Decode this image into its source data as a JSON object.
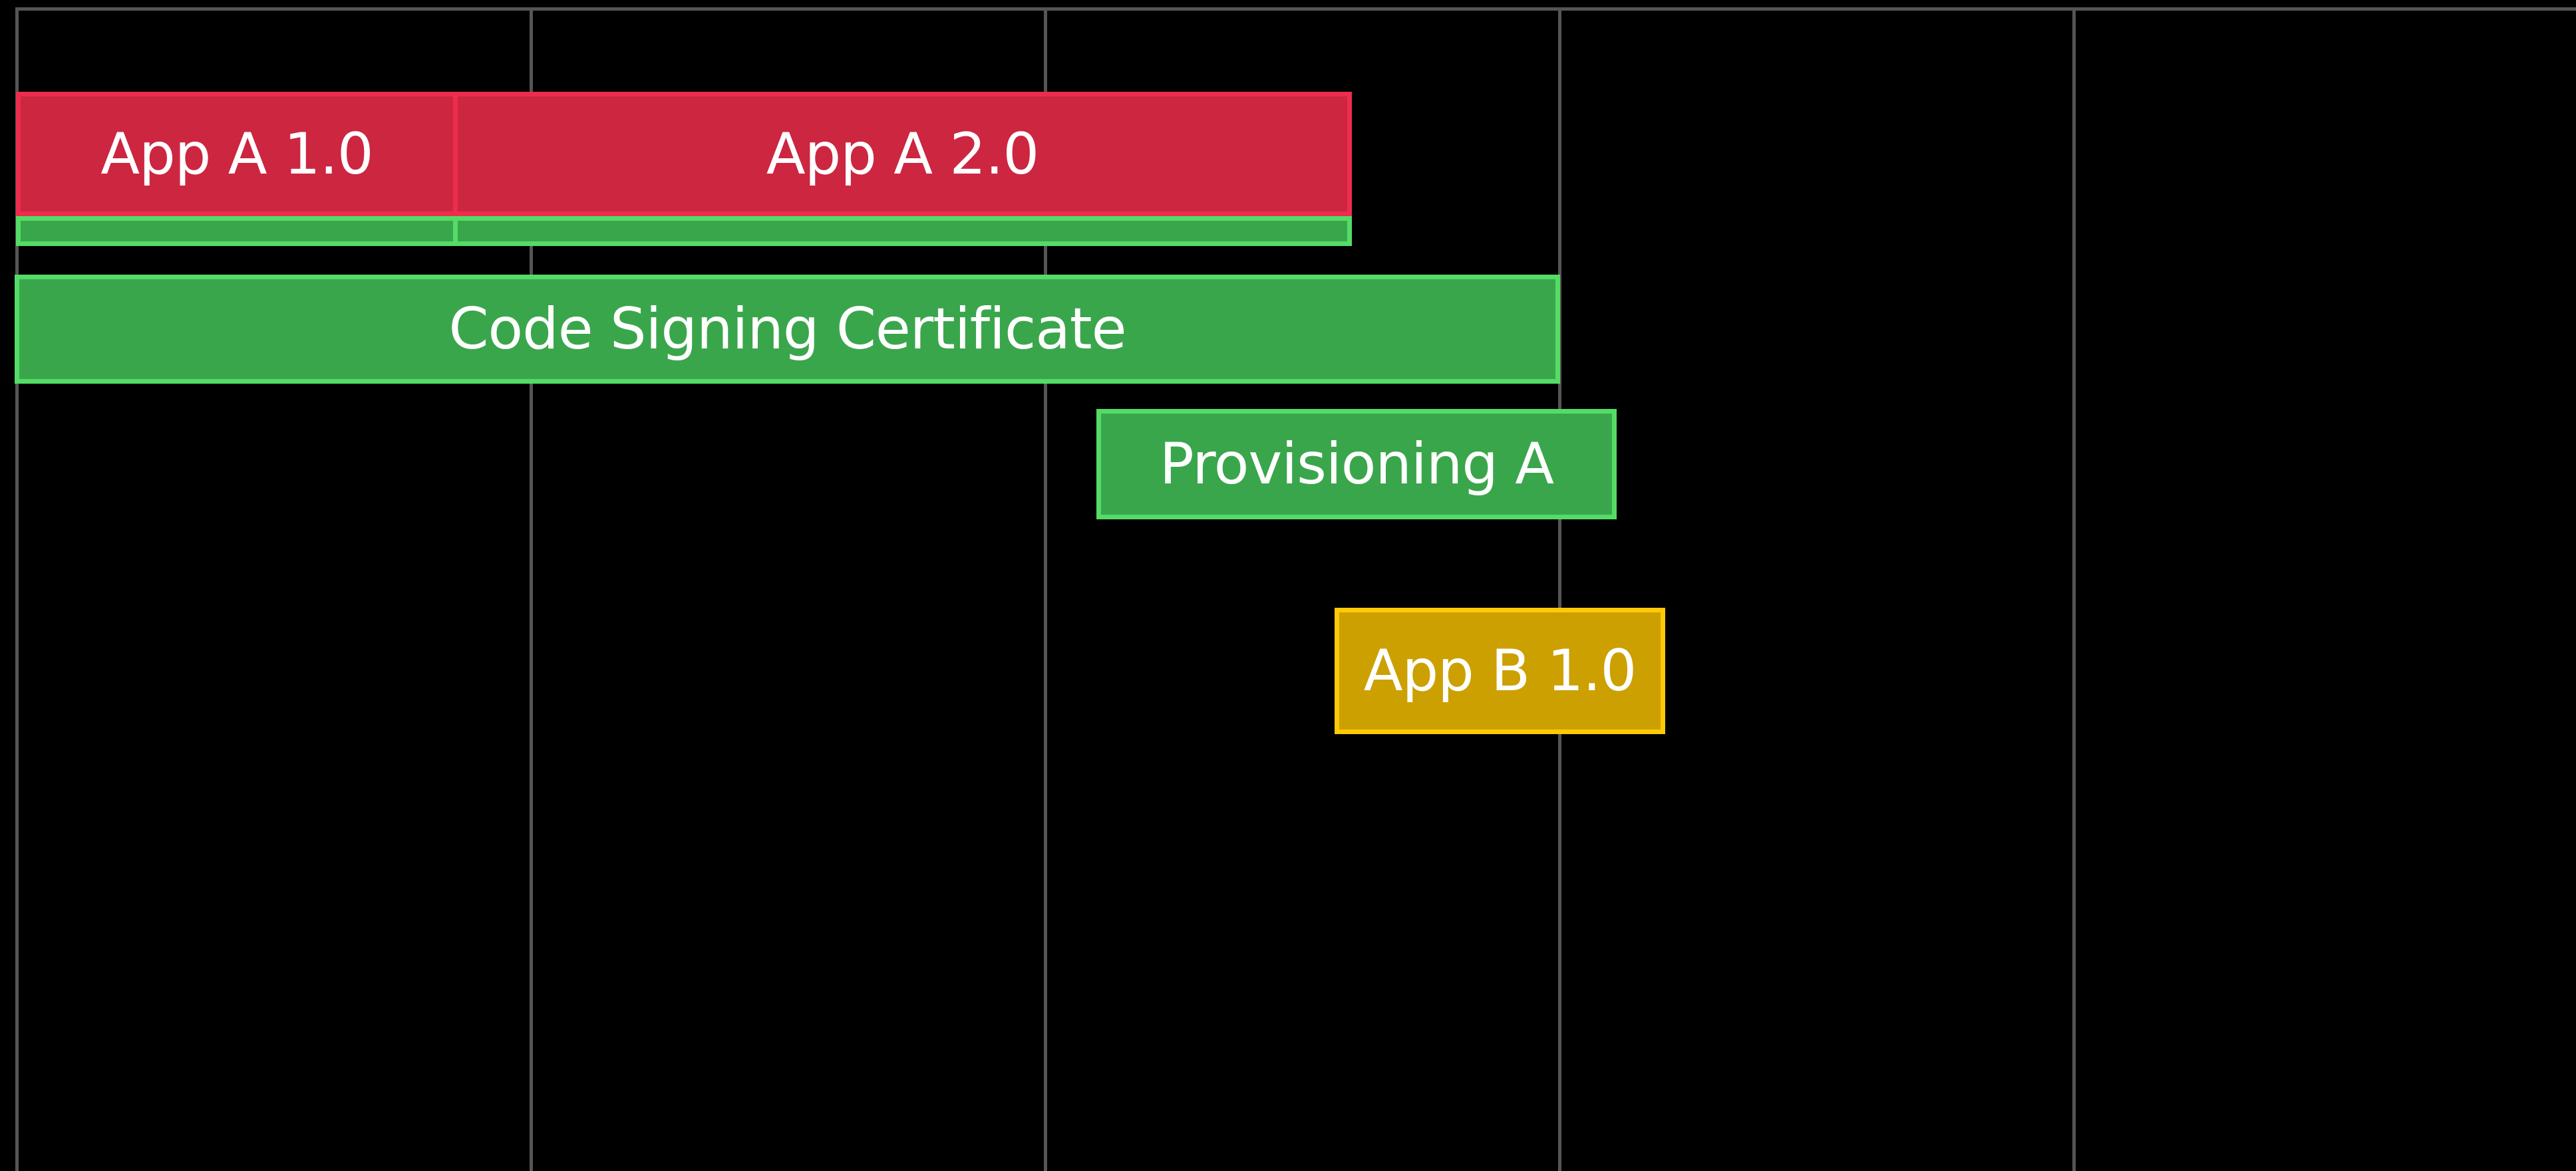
{
  "colors": {
    "background": "#000000",
    "grid": "#555555",
    "app_a_fill": "#cc2641",
    "app_a_border": "#ee2c4d",
    "signing_fill": "#3aa64c",
    "signing_border": "#54dc66",
    "app_b_fill": "#cca000",
    "app_b_border": "#ffc905"
  },
  "bars": {
    "app_a_1": {
      "label": "App A 1.0"
    },
    "app_a_2": {
      "label": "App A 2.0"
    },
    "code_signing_certificate": {
      "label": "Code Signing Certificate"
    },
    "provisioning_a": {
      "label": "Provisioning A"
    },
    "app_b_1": {
      "label": "App B 1.0"
    }
  }
}
